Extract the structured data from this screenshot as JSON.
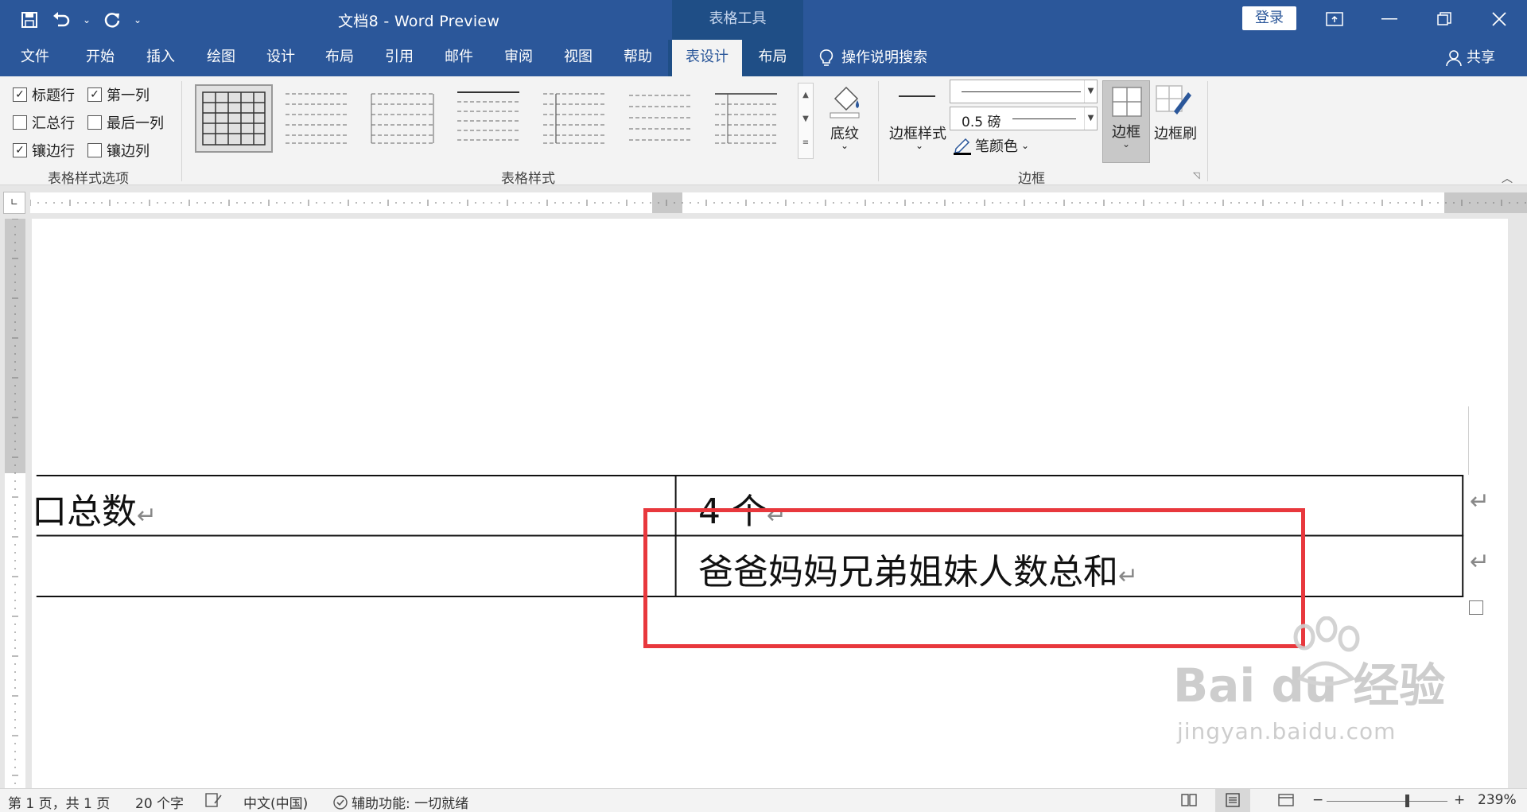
{
  "titlebar": {
    "doc_title": "文档8  -  Word Preview",
    "context_group": "表格工具",
    "login": "登录"
  },
  "tabs": [
    {
      "label": "文件"
    },
    {
      "label": "开始"
    },
    {
      "label": "插入"
    },
    {
      "label": "绘图"
    },
    {
      "label": "设计"
    },
    {
      "label": "布局"
    },
    {
      "label": "引用"
    },
    {
      "label": "邮件"
    },
    {
      "label": "审阅"
    },
    {
      "label": "视图"
    },
    {
      "label": "帮助"
    },
    {
      "label": "表设计"
    },
    {
      "label": "布局"
    }
  ],
  "tell_me": "操作说明搜索",
  "share": "共享",
  "ribbon": {
    "style_options": {
      "label": "表格样式选项",
      "header_row": "标题行",
      "first_column": "第一列",
      "total_row": "汇总行",
      "last_column": "最后一列",
      "banded_rows": "镶边行",
      "banded_columns": "镶边列"
    },
    "table_styles_label": "表格样式",
    "shading": "底纹",
    "borders_group": {
      "label": "边框",
      "border_styles": "边框样式",
      "weight": "0.5 磅",
      "pen_color": "笔颜色",
      "borders": "边框",
      "border_painter": "边框刷"
    }
  },
  "document": {
    "row1_left": "口总数",
    "row1_right": "4 个",
    "row2_left": "",
    "row2_right": "爸爸妈妈兄弟姐妹人数总和",
    "para_mark": "↵"
  },
  "watermark": {
    "logo_text": "Bai du 经验",
    "url": "jingyan.baidu.com"
  },
  "statusbar": {
    "page": "第 1 页，共 1 页",
    "words": "20 个字",
    "language": "中文(中国)",
    "accessibility": "辅助功能: 一切就绪",
    "zoom": "239%"
  },
  "colors": {
    "brand_blue": "#2b579a",
    "context_blue": "#1f4e86",
    "highlight_red": "#e8383d"
  }
}
